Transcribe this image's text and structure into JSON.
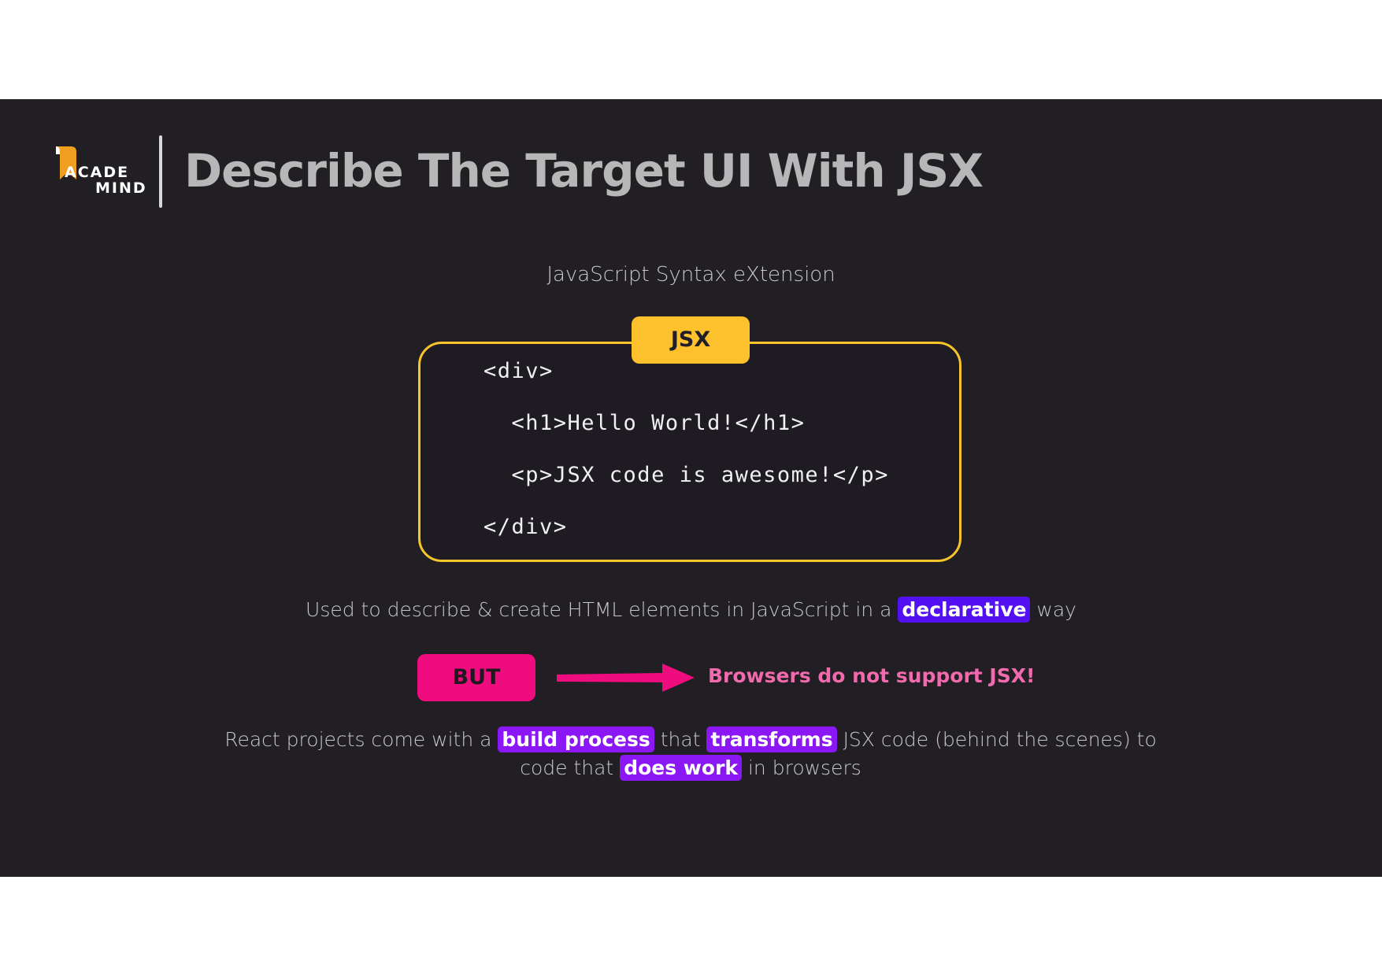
{
  "logo": {
    "line1": "ACADE",
    "line2": "MIND",
    "icon": "academind-bookmark-icon",
    "color": "#f0a020"
  },
  "slide": {
    "title": "Describe The Target UI With JSX",
    "subtitle": "JavaScript Syntax eXtension",
    "jsx_tag": "JSX",
    "code_lines": [
      "<div>",
      "  <h1>Hello World!</h1>",
      "  <p>JSX code is awesome!</p>",
      "</div>"
    ],
    "desc": {
      "before": "Used to describe & create HTML elements in JavaScript in a",
      "highlight": "declarative",
      "after": "way"
    },
    "but_label": "BUT",
    "arrow_icon": "right-arrow-icon",
    "warning": "Browsers do not support JSX!",
    "react": {
      "part1": "React projects come with a",
      "hl1": "build process",
      "part2": "that",
      "hl2": "transforms",
      "part3": "JSX code (behind the scenes) to code that",
      "hl3": "does work",
      "part4": "in browsers"
    }
  },
  "colors": {
    "background": "#211f24",
    "accent_yellow": "#fcc12d",
    "accent_pink": "#ef0c7e",
    "highlight_blue": "#5310f3",
    "highlight_purple": "#8b17f5",
    "warning_text": "#f26aae"
  }
}
